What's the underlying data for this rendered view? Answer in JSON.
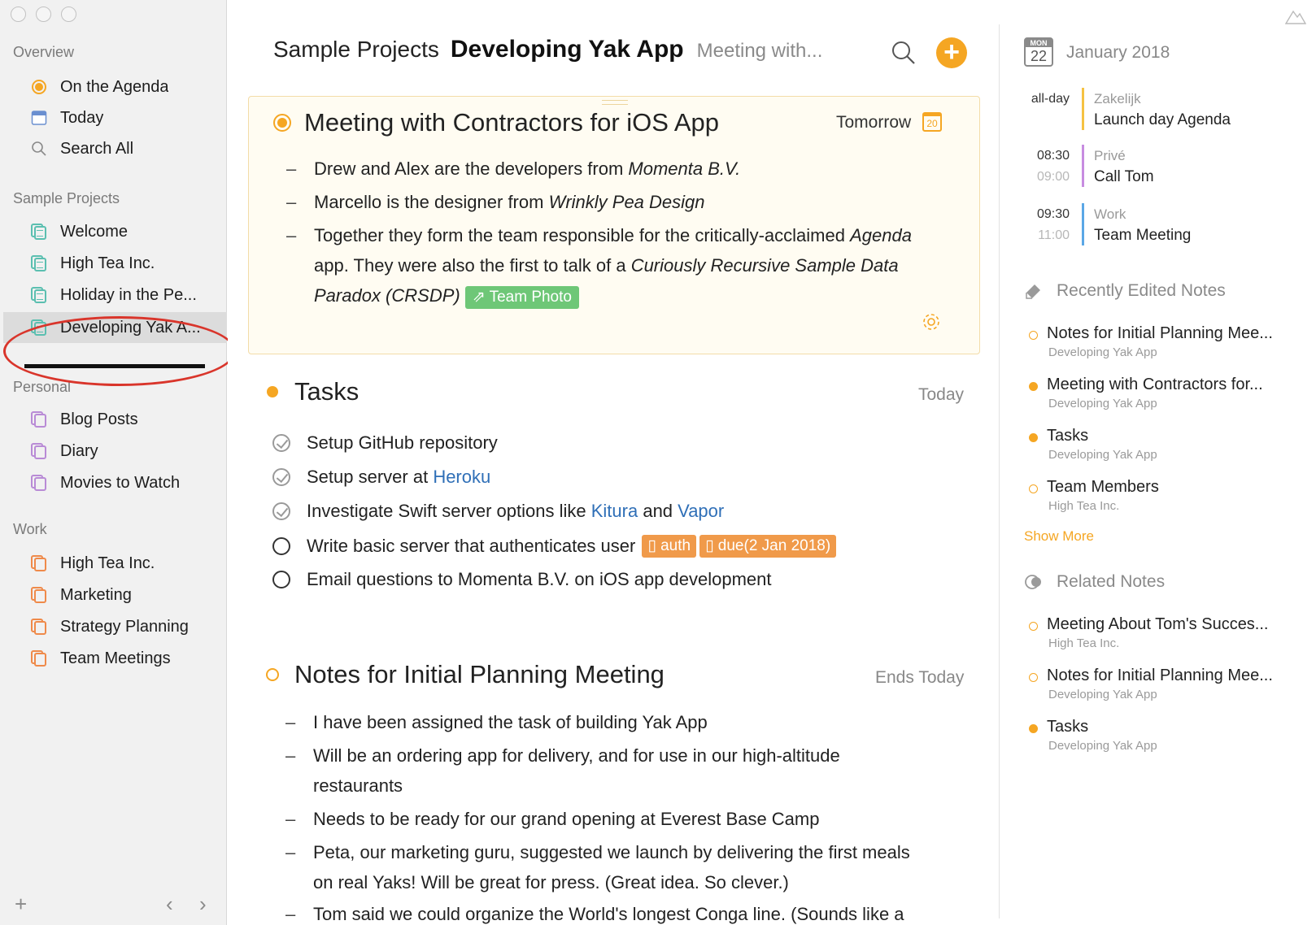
{
  "sidebar": {
    "sections": [
      {
        "title": "Overview"
      },
      {
        "title": "Sample Projects"
      },
      {
        "title": "Personal"
      },
      {
        "title": "Work"
      }
    ],
    "overview_items": [
      {
        "label": "On the Agenda",
        "icon": "agenda-dot-icon"
      },
      {
        "label": "Today",
        "icon": "calendar-icon"
      },
      {
        "label": "Search All",
        "icon": "search-icon"
      }
    ],
    "sample_projects": [
      {
        "label": "Welcome"
      },
      {
        "label": "High Tea Inc."
      },
      {
        "label": "Holiday in the Pe..."
      },
      {
        "label": "Developing Yak A..."
      }
    ],
    "personal_projects": [
      {
        "label": "Blog Posts"
      },
      {
        "label": "Diary"
      },
      {
        "label": "Movies to Watch"
      }
    ],
    "work_projects": [
      {
        "label": "High Tea Inc."
      },
      {
        "label": "Marketing"
      },
      {
        "label": "Strategy Planning"
      },
      {
        "label": "Team Meetings"
      }
    ],
    "footer": {
      "add": "+",
      "back": "‹",
      "forward": "›"
    }
  },
  "header": {
    "project": "Sample Projects",
    "document": "Developing Yak App",
    "note": "Meeting with..."
  },
  "notes": [
    {
      "title": "Meeting with Contractors for iOS App",
      "date": "Tomorrow",
      "cal_day": "20",
      "bullets": [
        {
          "dash": "–",
          "parts": [
            "Drew and Alex are the developers from ",
            "Momenta B.V."
          ]
        },
        {
          "dash": "–",
          "parts": [
            "Marcello is the designer from ",
            "Wrinkly Pea Design"
          ]
        },
        {
          "dash": "–",
          "parts": [
            "Together they form the team responsible for the critically-acclaimed ",
            "Agenda"
          ]
        },
        {
          "parts": [
            "app. They were also the first to talk of a ",
            "Curiously Recursive Sample Data"
          ]
        },
        {
          "parts": [
            "Paradox (CRSDP)",
            "Team Photo"
          ]
        }
      ]
    },
    {
      "title": "Tasks",
      "date": "Today",
      "tasks": [
        {
          "text": "Setup GitHub repository",
          "done": true
        },
        {
          "text": "Setup server at ",
          "link": "Heroku",
          "done": true
        },
        {
          "text": "Investigate Swift server options like ",
          "link": "Kitura",
          "mid": " and ",
          "link2": "Vapor",
          "done": true
        },
        {
          "text": "Write basic server that authenticates user",
          "tags": [
            "auth",
            "due(2 Jan 2018)"
          ],
          "done": false
        },
        {
          "text": "Email questions to Momenta B.V. on iOS app development",
          "done": false
        }
      ]
    },
    {
      "title": "Notes for Initial Planning Meeting",
      "date": "Ends Today",
      "bullets": [
        {
          "dash": "–",
          "text": "I have been assigned the task of building Yak App"
        },
        {
          "dash": "–",
          "text": "Will be an ordering app for delivery, and for use in our high-altitude"
        },
        {
          "text": "restaurants"
        },
        {
          "dash": "–",
          "text": "Needs to be ready for our grand opening at Everest Base Camp"
        },
        {
          "dash": "–",
          "text": "Peta, our marketing guru, suggested we launch by delivering the first meals"
        },
        {
          "text": "on real Yaks! Will be great for press. (Great idea. So clever.)"
        },
        {
          "dash": "–",
          "text": "Tom said we could organize the World's longest Conga line. (Sounds like a"
        }
      ]
    }
  ],
  "calendar": {
    "weekday": "MON",
    "day": "22",
    "month": "January 2018",
    "events": [
      {
        "start": "all-day",
        "end": "",
        "calendar": "Zakelijk",
        "title": "Launch day Agenda",
        "color": "#f5c242"
      },
      {
        "start": "08:30",
        "end": "09:00",
        "calendar": "Privé",
        "title": "Call Tom",
        "color": "#c78ce0"
      },
      {
        "start": "09:30",
        "end": "11:00",
        "calendar": "Work",
        "title": "Team Meeting",
        "color": "#5aa7e6"
      }
    ]
  },
  "recent": {
    "title": "Recently Edited Notes",
    "items": [
      {
        "title": "Notes for Initial Planning Mee...",
        "project": "Developing Yak App",
        "dot": "ring"
      },
      {
        "title": "Meeting with Contractors for...",
        "project": "Developing Yak App",
        "dot": "solid"
      },
      {
        "title": "Tasks",
        "project": "Developing Yak App",
        "dot": "solid"
      },
      {
        "title": "Team Members",
        "project": "High Tea Inc.",
        "dot": "ring"
      }
    ],
    "show_more": "Show More"
  },
  "related": {
    "title": "Related Notes",
    "items": [
      {
        "title": "Meeting About Tom's Succes...",
        "project": "High Tea Inc.",
        "dot": "ring"
      },
      {
        "title": "Notes for Initial Planning Mee...",
        "project": "Developing Yak App",
        "dot": "ring"
      },
      {
        "title": "Tasks",
        "project": "Developing Yak App",
        "dot": "solid"
      }
    ]
  },
  "colors": {
    "accent": "#f5a623",
    "tag_green": "#6ec777",
    "tag_orange": "#f09a4a",
    "annotation": "#d9352b",
    "link": "#2f6fb7"
  }
}
